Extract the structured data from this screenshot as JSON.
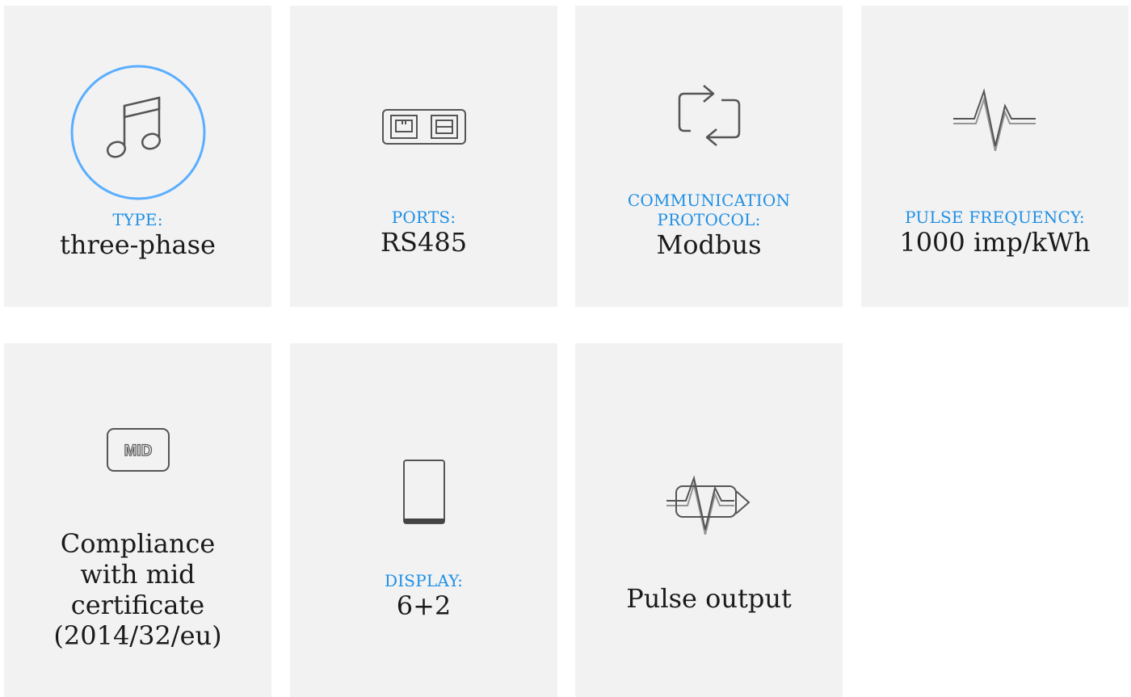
{
  "cards": [
    {
      "icon": "music-note-icon",
      "label": "TYPE:",
      "value": "three-phase"
    },
    {
      "icon": "ports-icon",
      "label": "PORTS:",
      "value": "RS485"
    },
    {
      "icon": "sync-arrows-icon",
      "label_line1": "COMMUNICATION",
      "label_line2": "PROTOCOL:",
      "value": "Modbus"
    },
    {
      "icon": "pulse-wave-icon",
      "label": "PULSE FREQUENCY:",
      "value": "1000 imp/kWh"
    },
    {
      "icon": "mid-badge-icon",
      "badge": "MID",
      "lines": [
        "Compliance",
        "with mid",
        "certificate",
        "(2014/32/eu)"
      ]
    },
    {
      "icon": "display-icon",
      "label": "DISPLAY:",
      "value": "6+2"
    },
    {
      "icon": "pulse-output-icon",
      "text": "Pulse output"
    }
  ],
  "colors": {
    "accent": "#1e90e6",
    "card_bg": "#f2f2f2",
    "circle": "#5aaeff"
  }
}
